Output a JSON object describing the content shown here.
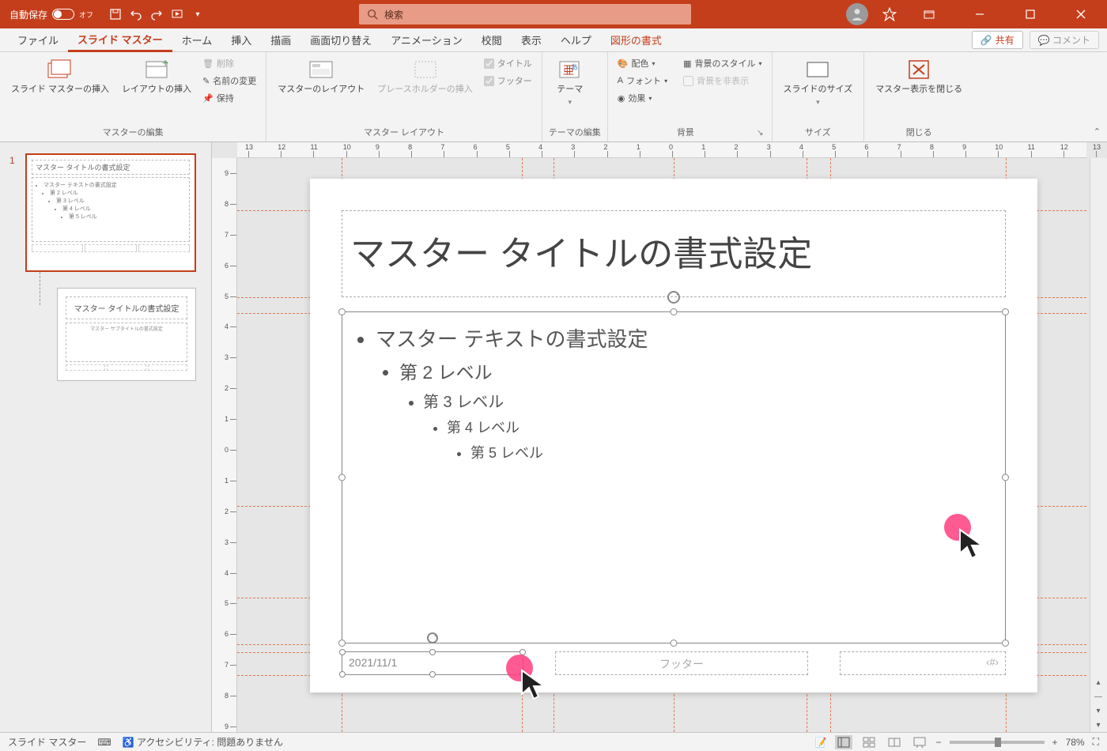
{
  "titlebar": {
    "autosave_label": "自動保存",
    "autosave_state": "オフ",
    "search_placeholder": "検索"
  },
  "tabs": {
    "file": "ファイル",
    "slide_master": "スライド マスター",
    "home": "ホーム",
    "insert": "挿入",
    "draw": "描画",
    "transitions": "画面切り替え",
    "animations": "アニメーション",
    "review": "校閲",
    "view": "表示",
    "help": "ヘルプ",
    "shape_format": "図形の書式",
    "share": "共有",
    "comments": "コメント"
  },
  "ribbon": {
    "edit_master": {
      "label": "マスターの編集",
      "insert_slide_master": "スライド マスターの挿入",
      "insert_layout": "レイアウトの挿入",
      "delete": "削除",
      "rename": "名前の変更",
      "preserve": "保持"
    },
    "master_layout": {
      "label": "マスター レイアウト",
      "master_layout_btn": "マスターのレイアウト",
      "insert_placeholder": "プレースホルダーの挿入",
      "title_chk": "タイトル",
      "footer_chk": "フッター"
    },
    "edit_theme": {
      "label": "テーマの編集",
      "themes": "テーマ"
    },
    "background": {
      "label": "背景",
      "colors": "配色",
      "fonts": "フォント",
      "effects": "効果",
      "bg_styles": "背景のスタイル",
      "hide_bg": "背景を非表示"
    },
    "size": {
      "label": "サイズ",
      "slide_size": "スライドのサイズ"
    },
    "close": {
      "label": "閉じる",
      "close_master": "マスター表示を閉じる"
    }
  },
  "ruler_h": [
    "13",
    "12",
    "11",
    "10",
    "9",
    "8",
    "7",
    "6",
    "5",
    "4",
    "3",
    "2",
    "1",
    "0",
    "1",
    "2",
    "3",
    "4",
    "5",
    "6",
    "7",
    "8",
    "9",
    "10",
    "11",
    "12",
    "13"
  ],
  "ruler_v": [
    "9",
    "8",
    "7",
    "6",
    "5",
    "4",
    "3",
    "2",
    "1",
    "0",
    "1",
    "2",
    "3",
    "4",
    "5",
    "6",
    "7",
    "8",
    "9"
  ],
  "thumbs": {
    "num1": "1",
    "master": {
      "title": "マスター タイトルの書式設定",
      "body_l1": "マスター テキストの書式設定",
      "body_l2": "第 2 レベル",
      "body_l3": "第 3 レベル",
      "body_l4": "第 4 レベル",
      "body_l5": "第 5 レベル"
    },
    "layout": {
      "title": "マスター タイトルの書式設定",
      "sub": "マスター サブタイトルの書式設定"
    }
  },
  "slide": {
    "title": "マスター タイトルの書式設定",
    "l1": "マスター テキストの書式設定",
    "l2": "第 2 レベル",
    "l3": "第 3 レベル",
    "l4": "第 4 レベル",
    "l5": "第 5 レベル",
    "date": "2021/11/1",
    "footer": "フッター",
    "pagenum": "‹#›"
  },
  "statusbar": {
    "mode": "スライド マスター",
    "accessibility": "アクセシビリティ: 問題ありません",
    "zoom": "78%"
  }
}
